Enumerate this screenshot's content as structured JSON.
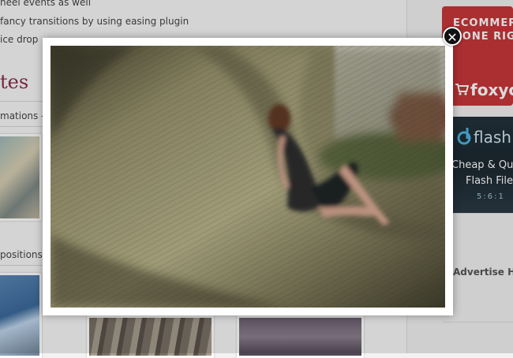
{
  "background_page": {
    "bullets": [
      "heel events as well",
      "fancy transitions by using easing plugin",
      "ice drop"
    ],
    "section_title": "tes",
    "section_subtitle": "mations -",
    "section_subtitle_2": "positions"
  },
  "sidebar": {
    "ad_foxycart": {
      "line1": "ECOMMER",
      "line2": "DONE RIGH",
      "brand": "foxyca"
    },
    "ad_flashfiles": {
      "brand": "flash",
      "tagline1": "Cheap & Qua",
      "tagline2": "Flash File",
      "digits": "5:6:1"
    },
    "advertise_label": "Advertise H"
  },
  "lightbox": {
    "image_name": "blurred-woman-wooden-ramp-photo",
    "close_symbol": "✕"
  },
  "colors": {
    "section_title": "#8a2b4a",
    "ad_foxycart_bg": "#c8363a",
    "lightbox_frame": "#ffffff",
    "close_button": "#111111"
  }
}
